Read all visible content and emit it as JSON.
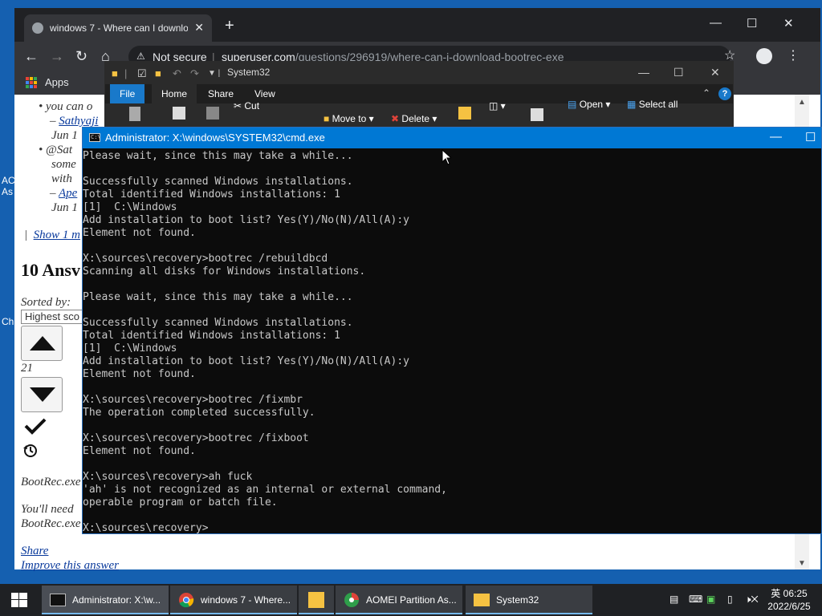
{
  "desktop": {
    "fragments": [
      "AC",
      "As",
      "Ch"
    ]
  },
  "chrome": {
    "tab_title": "windows 7 - Where can I download bootrec.exe",
    "new_tab_glyph": "+",
    "not_secure": "Not secure",
    "url_host": "superuser.com",
    "url_path": "/questions/296919/where-can-i-download-bootrec-exe",
    "bookmark_apps": "Apps",
    "minimize_glyph": "—",
    "maximize_glyph": "☐",
    "close_glyph": "✕"
  },
  "page": {
    "comment1_line1": "you can o",
    "comment1_author": "Sathyaji",
    "comment1_date": "Jun 1",
    "comment2_line1": "@Sat",
    "comment2_line2": "some",
    "comment2_line3": "with",
    "comment2_author": "Ape",
    "comment2_date": "Jun 1",
    "show_more": "Show 1 m",
    "answers_heading": "10 Ansv",
    "sorted_by": "Sorted by:",
    "sort_value": "Highest sco",
    "vote_count": "21",
    "answer_line1": "BootRec.exe",
    "answer_line2": "You'll need",
    "answer_line3": "BootRec.exe",
    "share_link": "Share",
    "improve_link": "Improve this answer"
  },
  "explorer": {
    "title": "System32",
    "tabs": [
      "File",
      "Home",
      "Share",
      "View"
    ],
    "ribbon": {
      "cut": "Cut",
      "move_to": "Move to",
      "delete": "Delete",
      "open": "Open",
      "select_all": "Select all"
    }
  },
  "cmd": {
    "title": "Administrator: X:\\windows\\SYSTEM32\\cmd.exe",
    "lines": [
      "Please wait, since this may take a while...",
      "",
      "Successfully scanned Windows installations.",
      "Total identified Windows installations: 1",
      "[1]  C:\\Windows",
      "Add installation to boot list? Yes(Y)/No(N)/All(A):y",
      "Element not found.",
      "",
      "X:\\sources\\recovery>bootrec /rebuildbcd",
      "Scanning all disks for Windows installations.",
      "",
      "Please wait, since this may take a while...",
      "",
      "Successfully scanned Windows installations.",
      "Total identified Windows installations: 1",
      "[1]  C:\\Windows",
      "Add installation to boot list? Yes(Y)/No(N)/All(A):y",
      "Element not found.",
      "",
      "X:\\sources\\recovery>bootrec /fixmbr",
      "The operation completed successfully.",
      "",
      "X:\\sources\\recovery>bootrec /fixboot",
      "Element not found.",
      "",
      "X:\\sources\\recovery>ah fuck",
      "'ah' is not recognized as an internal or external command,",
      "operable program or batch file.",
      "",
      "X:\\sources\\recovery>"
    ]
  },
  "taskbar": {
    "items": [
      {
        "label": "Administrator: X:\\w...",
        "icon": "cmd-icon"
      },
      {
        "label": "windows 7 - Where...",
        "icon": "chrome-icon"
      },
      {
        "label": "",
        "icon": "file-explorer-icon"
      },
      {
        "label": "AOMEI Partition As...",
        "icon": "aomei-icon"
      },
      {
        "label": "System32",
        "icon": "folder-icon"
      }
    ],
    "ime": "英",
    "time": "06:25",
    "date": "2022/6/25"
  }
}
